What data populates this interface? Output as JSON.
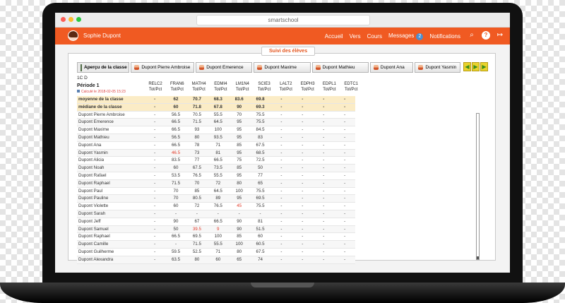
{
  "browser": {
    "url": "smartschool"
  },
  "colors": {
    "brand": "#f05a22",
    "accent": "#e4561f",
    "low_grade": "#e23b2a"
  },
  "user": {
    "name": "Sophie Dupont"
  },
  "nav": {
    "links": [
      "Accueil",
      "Vers",
      "Cours",
      "Messages",
      "Notifications"
    ],
    "messages_count": "2",
    "icons": [
      "search-icon",
      "help-icon",
      "logout-icon"
    ]
  },
  "panel": {
    "title": "Suivi des élèves"
  },
  "student_tabs": [
    "Aperçu de la classe",
    "Dupont Pierre Ambroise",
    "Dupont Emerence",
    "Dupont Maxime",
    "Dupont Mathieu",
    "Dupont Ana",
    "Dupont Yasmin"
  ],
  "class_label": "1C D",
  "period": {
    "label": "Période 1",
    "calc": "Calculé le 2018-02-05 15:23"
  },
  "table": {
    "columns": [
      {
        "name": "RELC2",
        "sub": "Tot/Pct"
      },
      {
        "name": "FRAN6",
        "sub": "Tot/Pct"
      },
      {
        "name": "MATH4",
        "sub": "Tot/Pct"
      },
      {
        "name": "EDMI4",
        "sub": "Tot/Pct"
      },
      {
        "name": "LM1N4",
        "sub": "Tot/Pct"
      },
      {
        "name": "SCIE3",
        "sub": "Tot/Pct"
      },
      {
        "name": "LALT2",
        "sub": "Tot/Pct"
      },
      {
        "name": "EDPH3",
        "sub": "Tot/Pct"
      },
      {
        "name": "EDPL1",
        "sub": "Tot/Pct"
      },
      {
        "name": "EDTC1",
        "sub": "Tot/Pct"
      }
    ],
    "summary": [
      {
        "name": "moyenne de la classe",
        "values": [
          "-",
          "62",
          "70.7",
          "68.3",
          "83.6",
          "69.8",
          "-",
          "-",
          "-",
          "-"
        ]
      },
      {
        "name": "médiane de la classe",
        "values": [
          "-",
          "60",
          "71.8",
          "67.8",
          "90",
          "69.3",
          "-",
          "-",
          "-",
          "-"
        ]
      }
    ],
    "rows": [
      {
        "name": "Dupont Pierre Ambroise",
        "values": [
          "-",
          "56.5",
          "70.5",
          "55.5",
          "70",
          "75.5",
          "-",
          "-",
          "-",
          "-"
        ]
      },
      {
        "name": "Dupont Emerence",
        "values": [
          "-",
          "66.5",
          "71.5",
          "64.5",
          "95",
          "75.5",
          "-",
          "-",
          "-",
          "-"
        ]
      },
      {
        "name": "Dupont Maxime",
        "values": [
          "-",
          "66.5",
          "93",
          "100",
          "95",
          "84.5",
          "-",
          "-",
          "-",
          "-"
        ]
      },
      {
        "name": "Dupont Mathieu",
        "values": [
          "-",
          "56.5",
          "80",
          "93.5",
          "95",
          "83",
          "-",
          "-",
          "-",
          "-"
        ]
      },
      {
        "name": "Dupont Ana",
        "values": [
          "-",
          "66.5",
          "78",
          "71",
          "85",
          "67.5",
          "-",
          "-",
          "-",
          "-"
        ]
      },
      {
        "name": "Dupont Yasmin",
        "values": [
          "-",
          "46.5",
          "73",
          "81",
          "95",
          "68.5",
          "-",
          "-",
          "-",
          "-"
        ]
      },
      {
        "name": "Dupont Alicia",
        "values": [
          "-",
          "83.5",
          "77",
          "66.5",
          "75",
          "72.5",
          "-",
          "-",
          "-",
          "-"
        ]
      },
      {
        "name": "Dupont Noah",
        "values": [
          "-",
          "60",
          "67.5",
          "73.5",
          "85",
          "50",
          "-",
          "-",
          "-",
          "-"
        ]
      },
      {
        "name": "Dupont Rafael",
        "values": [
          "-",
          "53.5",
          "76.5",
          "55.5",
          "95",
          "77",
          "-",
          "-",
          "-",
          "-"
        ]
      },
      {
        "name": "Dupont Raphael",
        "values": [
          "-",
          "71.5",
          "70",
          "72",
          "80",
          "65",
          "-",
          "-",
          "-",
          "-"
        ]
      },
      {
        "name": "Dupont Paul",
        "values": [
          "-",
          "70",
          "85",
          "64.5",
          "100",
          "75.5",
          "-",
          "-",
          "-",
          "-"
        ]
      },
      {
        "name": "Dupont Pauline",
        "values": [
          "-",
          "70",
          "80.5",
          "89",
          "95",
          "69.5",
          "-",
          "-",
          "-",
          "-"
        ]
      },
      {
        "name": "Dupont Violette",
        "values": [
          "-",
          "60",
          "72",
          "76.5",
          "45",
          "75.5",
          "-",
          "-",
          "-",
          "-"
        ]
      },
      {
        "name": "Dupont Sarah",
        "values": [
          "-",
          "-",
          "-",
          "-",
          "-",
          "-",
          "-",
          "-",
          "-",
          "-"
        ]
      },
      {
        "name": "Dupont Jeff",
        "values": [
          "-",
          "90",
          "67",
          "66.5",
          "90",
          "81",
          "-",
          "-",
          "-",
          "-"
        ]
      },
      {
        "name": "Dupont Samuel",
        "values": [
          "-",
          "50",
          "39.5",
          "9",
          "90",
          "51.5",
          "-",
          "-",
          "-",
          "-"
        ]
      },
      {
        "name": "Dupont Raphael",
        "values": [
          "-",
          "66.5",
          "69.5",
          "100",
          "85",
          "60",
          "-",
          "-",
          "-",
          "-"
        ]
      },
      {
        "name": "Dupont Camille",
        "values": [
          "-",
          "-",
          "71.5",
          "55.5",
          "100",
          "60.5",
          "-",
          "-",
          "-",
          "-"
        ]
      },
      {
        "name": "Dupont Guilherme",
        "values": [
          "-",
          "59.5",
          "52.5",
          "71",
          "80",
          "67.5",
          "-",
          "-",
          "-",
          "-"
        ]
      },
      {
        "name": "Dupont Alexandra",
        "values": [
          "-",
          "63.5",
          "80",
          "60",
          "65",
          "74",
          "-",
          "-",
          "-",
          "-"
        ]
      }
    ],
    "low_marks": [
      "46.5",
      "39.5",
      "9",
      "45"
    ]
  }
}
